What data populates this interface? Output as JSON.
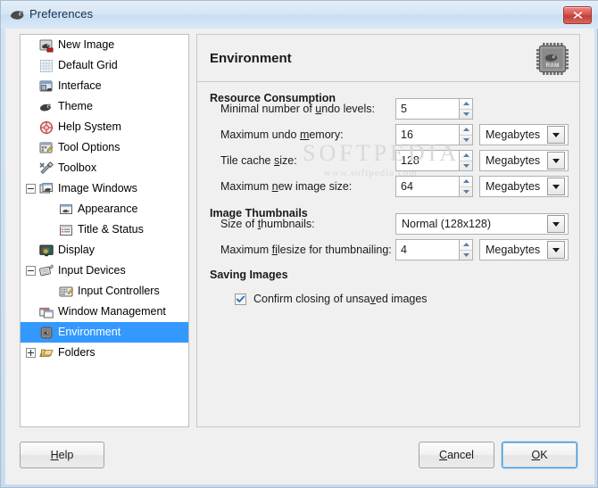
{
  "window": {
    "title": "Preferences",
    "icon": "wilber-icon",
    "close_label": "x"
  },
  "sidebar": {
    "items": [
      {
        "label": "New Image",
        "icon": "new-image-icon",
        "indent": 0,
        "expander": "none",
        "selected": false
      },
      {
        "label": "Default Grid",
        "icon": "default-grid-icon",
        "indent": 0,
        "expander": "none",
        "selected": false
      },
      {
        "label": "Interface",
        "icon": "interface-icon",
        "indent": 0,
        "expander": "none",
        "selected": false
      },
      {
        "label": "Theme",
        "icon": "theme-icon",
        "indent": 0,
        "expander": "none",
        "selected": false
      },
      {
        "label": "Help System",
        "icon": "help-system-icon",
        "indent": 0,
        "expander": "none",
        "selected": false
      },
      {
        "label": "Tool Options",
        "icon": "tool-options-icon",
        "indent": 0,
        "expander": "none",
        "selected": false
      },
      {
        "label": "Toolbox",
        "icon": "toolbox-icon",
        "indent": 0,
        "expander": "none",
        "selected": false
      },
      {
        "label": "Image Windows",
        "icon": "image-windows-icon",
        "indent": 0,
        "expander": "minus",
        "selected": false
      },
      {
        "label": "Appearance",
        "icon": "appearance-icon",
        "indent": 1,
        "expander": "none",
        "selected": false
      },
      {
        "label": "Title & Status",
        "icon": "title-status-icon",
        "indent": 1,
        "expander": "none",
        "selected": false
      },
      {
        "label": "Display",
        "icon": "display-icon",
        "indent": 0,
        "expander": "none",
        "selected": false
      },
      {
        "label": "Input Devices",
        "icon": "input-devices-icon",
        "indent": 0,
        "expander": "minus",
        "selected": false
      },
      {
        "label": "Input Controllers",
        "icon": "input-controllers-icon",
        "indent": 1,
        "expander": "none",
        "selected": false
      },
      {
        "label": "Window Management",
        "icon": "window-management-icon",
        "indent": 0,
        "expander": "none",
        "selected": false
      },
      {
        "label": "Environment",
        "icon": "environment-icon",
        "indent": 0,
        "expander": "none",
        "selected": true
      },
      {
        "label": "Folders",
        "icon": "folders-icon",
        "indent": 0,
        "expander": "plus",
        "selected": false
      }
    ]
  },
  "page": {
    "title": "Environment",
    "header_icon": "ram-chip-icon",
    "sections": {
      "resource_consumption": {
        "title": "Resource Consumption",
        "fields": [
          {
            "label_pre": "Minimal number of ",
            "label_mnemonic": "u",
            "label_post": "ndo levels:",
            "value": "5",
            "unit": null
          },
          {
            "label_pre": "Maximum undo ",
            "label_mnemonic": "m",
            "label_post": "emory:",
            "value": "16",
            "unit": "Megabytes"
          },
          {
            "label_pre": "Tile cache ",
            "label_mnemonic": "s",
            "label_post": "ize:",
            "value": "128",
            "unit": "Megabytes"
          },
          {
            "label_pre": "Maximum ",
            "label_mnemonic": "n",
            "label_post": "ew image size:",
            "value": "64",
            "unit": "Megabytes"
          }
        ]
      },
      "image_thumbnails": {
        "title": "Image Thumbnails",
        "size_label_pre": "Size of ",
        "size_label_mnemonic": "t",
        "size_label_post": "humbnails:",
        "size_value": "Normal (128x128)",
        "filesize_label_pre": "Maximum ",
        "filesize_label_mnemonic": "fi",
        "filesize_label_post": "lesize for thumbnailing:",
        "filesize_value": "4",
        "filesize_unit": "Megabytes"
      },
      "saving_images": {
        "title": "Saving Images",
        "confirm_pre": "Confirm closing of unsa",
        "confirm_mnemonic": "v",
        "confirm_post": "ed images",
        "confirm_checked": true
      }
    }
  },
  "buttons": {
    "help_pre": "",
    "help_mnemonic": "H",
    "help_post": "elp",
    "cancel_pre": "",
    "cancel_mnemonic": "C",
    "cancel_post": "ancel",
    "ok_pre": "",
    "ok_mnemonic": "O",
    "ok_post": "K"
  },
  "watermark": {
    "line1": "SOFTPEDIA",
    "line2": "www.softpedia.com"
  },
  "colors": {
    "selection": "#3399ff",
    "titlebar": "#d6e6f5",
    "close_button": "#c03e36",
    "focus_ring": "#3c94d4"
  }
}
